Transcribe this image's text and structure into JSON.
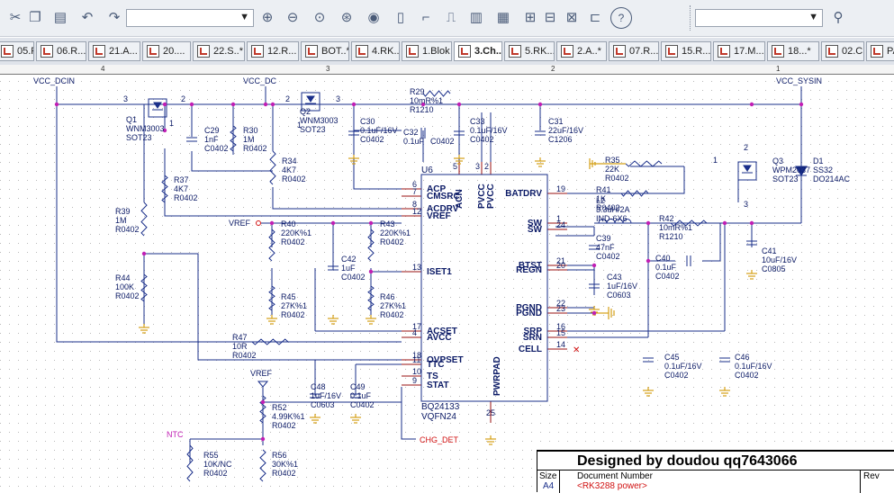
{
  "toolbar": {
    "part_combo_value": "",
    "search_combo_value": "",
    "icons": [
      "scissors-icon",
      "copy-icon",
      "paste-icon",
      "undo-icon",
      "redo-icon",
      "zoom-in-icon",
      "zoom-out-icon",
      "zoom-area-icon",
      "zoom-fit-icon",
      "eye-icon",
      "place-part-icon",
      "place-wire-icon",
      "place-net-icon",
      "place-bus-icon",
      "place-junction-icon",
      "place-power-icon",
      "place-gnd-icon",
      "place-port-icon",
      "place-offpage-icon",
      "help-icon",
      "binoculars-icon"
    ],
    "colors": {
      "bg": "#eceff3",
      "accent": "#4a5b78"
    }
  },
  "tabs": [
    {
      "label": "05.R..."
    },
    {
      "label": "06.R..."
    },
    {
      "label": "21.A..."
    },
    {
      "label": "20...."
    },
    {
      "label": "22.S..*"
    },
    {
      "label": "12.R..."
    },
    {
      "label": "BOT..*"
    },
    {
      "label": "4.RK..."
    },
    {
      "label": "1.Blok"
    },
    {
      "label": "3.Ch..*",
      "active": true
    },
    {
      "label": "5.RK..."
    },
    {
      "label": "2.A..*"
    },
    {
      "label": "07.R..."
    },
    {
      "label": "15.R..."
    },
    {
      "label": "17.M..."
    },
    {
      "label": "18...*"
    },
    {
      "label": "02.C..."
    },
    {
      "label": "PA"
    }
  ],
  "ruler": {
    "labels": [
      "4",
      "3",
      "2",
      "1"
    ]
  },
  "schematic": {
    "nets": {
      "vcc_dcin": "VCC_DCIN",
      "vcc_dc": "VCC_DC",
      "vcc_sysin": "VCC_SYSIN",
      "vref_left": "VREF",
      "vref_bottom": "VREF",
      "ntc": "NTC",
      "chg_det": "CHG_DET"
    },
    "ic": {
      "ref": "U6",
      "part": "BQ24133",
      "package": "VQFN24",
      "pins_left": [
        {
          "num": "6",
          "name": "ACP"
        },
        {
          "num": "7",
          "name": "CMSRC"
        },
        {
          "num": "8",
          "name": "ACDRV"
        },
        {
          "num": "12",
          "name": "VREF"
        },
        {
          "num": "13",
          "name": "ISET1"
        },
        {
          "num": "17",
          "name": "ACSET"
        },
        {
          "num": "4",
          "name": "AVCC"
        },
        {
          "num": "18",
          "name": "OVPSET"
        },
        {
          "num": "11",
          "name": "TTC"
        },
        {
          "num": "10",
          "name": "TS"
        },
        {
          "num": "9",
          "name": "STAT"
        }
      ],
      "pins_right": [
        {
          "num": "19",
          "name": "BATDRV"
        },
        {
          "num": "1",
          "name": "SW"
        },
        {
          "num": "24",
          "name": "SW"
        },
        {
          "num": "21",
          "name": "BTST"
        },
        {
          "num": "20",
          "name": "REGN"
        },
        {
          "num": "22",
          "name": "PGND"
        },
        {
          "num": "23",
          "name": "PGND"
        },
        {
          "num": "16",
          "name": "SRP"
        },
        {
          "num": "15",
          "name": "SRN"
        },
        {
          "num": "14",
          "name": "CELL"
        }
      ],
      "pins_top": [
        {
          "num": "5",
          "name": "ACN"
        },
        {
          "num": "3",
          "name": "PVCC"
        },
        {
          "num": "2",
          "name": "PVCC"
        }
      ],
      "pin_bottom": {
        "num": "25",
        "name": "PWRPAD"
      }
    },
    "components": [
      {
        "id": "q1",
        "lines": [
          "Q1",
          "WNM3003",
          "SOT23"
        ],
        "pins": [
          "3",
          "2",
          "1"
        ]
      },
      {
        "id": "q2",
        "lines": [
          "Q2",
          "WNM3003",
          "SOT23"
        ],
        "pins": [
          "2",
          "3",
          "1"
        ]
      },
      {
        "id": "q3",
        "lines": [
          "Q3",
          "WPM2037",
          "SOT23"
        ],
        "pins": [
          "2",
          "1",
          "3"
        ]
      },
      {
        "id": "d1",
        "lines": [
          "D1",
          "SS32",
          "DO214AC"
        ]
      },
      {
        "id": "c29",
        "lines": [
          "C29",
          "1nF",
          "C0402"
        ]
      },
      {
        "id": "r30",
        "lines": [
          "R30",
          "1M",
          "R0402"
        ]
      },
      {
        "id": "r29",
        "lines": [
          "R29",
          "10mR%1",
          "R1210"
        ]
      },
      {
        "id": "c30",
        "lines": [
          "C30",
          "0.1uF/16V",
          "C0402"
        ]
      },
      {
        "id": "c32",
        "lines": [
          "C32",
          "0.1uF",
          "C0402"
        ]
      },
      {
        "id": "c33",
        "lines": [
          "C33",
          "0.1uF/16V",
          "C0402"
        ]
      },
      {
        "id": "c31",
        "lines": [
          "C31",
          "22uF/16V",
          "C1206"
        ]
      },
      {
        "id": "r34",
        "lines": [
          "R34",
          "4K7",
          "R0402"
        ]
      },
      {
        "id": "r37",
        "lines": [
          "R37",
          "4K7",
          "R0402"
        ]
      },
      {
        "id": "r39",
        "lines": [
          "R39",
          "1M",
          "R0402"
        ]
      },
      {
        "id": "r44",
        "lines": [
          "R44",
          "100K",
          "R0402"
        ]
      },
      {
        "id": "r35",
        "lines": [
          "R35",
          "22K",
          "R0402"
        ]
      },
      {
        "id": "r41",
        "lines": [
          "R41",
          "1K",
          "R0402"
        ]
      },
      {
        "id": "l2",
        "lines": [
          "L2",
          "3.3uH/2A",
          "IND-6X6"
        ]
      },
      {
        "id": "r42",
        "lines": [
          "R42",
          "10mR%1",
          "R1210"
        ]
      },
      {
        "id": "c39",
        "lines": [
          "C39",
          "47nF",
          "C0402"
        ]
      },
      {
        "id": "c43",
        "lines": [
          "C43",
          "1uF/16V",
          "C0603"
        ]
      },
      {
        "id": "c40",
        "lines": [
          "C40",
          "0.1uF",
          "C0402"
        ]
      },
      {
        "id": "c41",
        "lines": [
          "C41",
          "10uF/16V",
          "C0805"
        ]
      },
      {
        "id": "r40",
        "lines": [
          "R40",
          "220K%1",
          "R0402"
        ]
      },
      {
        "id": "c42",
        "lines": [
          "C42",
          "1uF",
          "C0402"
        ]
      },
      {
        "id": "r43",
        "lines": [
          "R43",
          "220K%1",
          "R0402"
        ]
      },
      {
        "id": "r45",
        "lines": [
          "R45",
          "27K%1",
          "R0402"
        ]
      },
      {
        "id": "r46",
        "lines": [
          "R46",
          "27K%1",
          "R0402"
        ]
      },
      {
        "id": "r47",
        "lines": [
          "R47",
          "10R",
          "R0402"
        ]
      },
      {
        "id": "c48",
        "lines": [
          "C48",
          "1uF/16V",
          "C0603"
        ]
      },
      {
        "id": "c49",
        "lines": [
          "C49",
          "0.1uF",
          "C0402"
        ]
      },
      {
        "id": "r52",
        "lines": [
          "R52",
          "4.99K%1",
          "R0402"
        ]
      },
      {
        "id": "c45",
        "lines": [
          "C45",
          "0.1uF/16V",
          "C0402"
        ]
      },
      {
        "id": "c46",
        "lines": [
          "C46",
          "0.1uF/16V",
          "C0402"
        ]
      },
      {
        "id": "r55",
        "lines": [
          "R55",
          "10K/NC",
          "R0402"
        ]
      },
      {
        "id": "r56",
        "lines": [
          "R56",
          "30K%1",
          "R0402"
        ]
      }
    ],
    "colors": {
      "wire": "#1a2f8a",
      "part": "#1a2f8a",
      "pin": "#9a1010",
      "text": "#0b1a66",
      "dot": "#c21fb4",
      "gnd": "#d4a017",
      "net": "#c21fb4",
      "port": "#d11212"
    }
  },
  "titleblock": {
    "designed": "Designed by doudou qq7643066",
    "size_label": "Size",
    "size_value": "A4",
    "docnum_label": "Document Number",
    "docnum_value": "<RK3288 power>",
    "rev_label": "Rev"
  }
}
